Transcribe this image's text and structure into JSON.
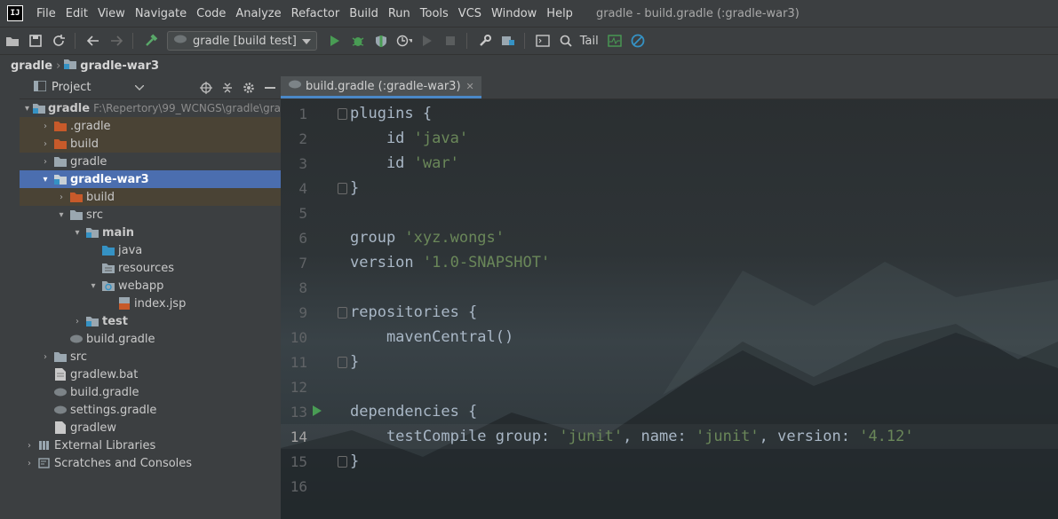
{
  "menubar": {
    "items": [
      "File",
      "Edit",
      "View",
      "Navigate",
      "Code",
      "Analyze",
      "Refactor",
      "Build",
      "Run",
      "Tools",
      "VCS",
      "Window",
      "Help"
    ],
    "window_title": "gradle - build.gradle (:gradle-war3)"
  },
  "toolbar": {
    "run_config": "gradle [build test]",
    "tail_label": "Tail"
  },
  "breadcrumb": [
    "gradle",
    "gradle-war3"
  ],
  "project_panel": {
    "title": "Project"
  },
  "tree": [
    {
      "label": "gradle",
      "path": "F:\\Repertory\\99_WCNGS\\gradle\\gra",
      "bold": true,
      "expanded": true
    },
    {
      "label": ".gradle",
      "excluded": true
    },
    {
      "label": "build",
      "excluded": true
    },
    {
      "label": "gradle"
    },
    {
      "label": "gradle-war3",
      "selected": true,
      "bold": true
    },
    {
      "label": "build",
      "excluded": true
    },
    {
      "label": "src"
    },
    {
      "label": "main",
      "bold": true
    },
    {
      "label": "java"
    },
    {
      "label": "resources"
    },
    {
      "label": "webapp"
    },
    {
      "label": "index.jsp"
    },
    {
      "label": "test",
      "bold": true
    },
    {
      "label": "build.gradle"
    },
    {
      "label": "src"
    },
    {
      "label": "gradlew.bat"
    },
    {
      "label": "build.gradle"
    },
    {
      "label": "settings.gradle"
    },
    {
      "label": "gradlew"
    },
    {
      "label": "External Libraries"
    },
    {
      "label": "Scratches and Consoles"
    }
  ],
  "editor": {
    "tab_label": "build.gradle (:gradle-war3)",
    "current_line": 14,
    "lines": [
      {
        "n": "1",
        "code": "plugins {"
      },
      {
        "n": "2",
        "code": "    id 'java'"
      },
      {
        "n": "3",
        "code": "    id 'war'"
      },
      {
        "n": "4",
        "code": "}"
      },
      {
        "n": "5",
        "code": ""
      },
      {
        "n": "6",
        "code": "group 'xyz.wongs'"
      },
      {
        "n": "7",
        "code": "version '1.0-SNAPSHOT'"
      },
      {
        "n": "8",
        "code": ""
      },
      {
        "n": "9",
        "code": "repositories {"
      },
      {
        "n": "10",
        "code": "    mavenCentral()"
      },
      {
        "n": "11",
        "code": "}"
      },
      {
        "n": "12",
        "code": ""
      },
      {
        "n": "13",
        "code": "dependencies {"
      },
      {
        "n": "14",
        "code": "    testCompile group: 'junit', name: 'junit', version: '4.12'"
      },
      {
        "n": "15",
        "code": "}"
      },
      {
        "n": "16",
        "code": ""
      }
    ]
  },
  "colors": {
    "accent": "#4b6eaf",
    "string": "#6a8759",
    "run": "#499c54",
    "excluded_folder": "#c75a2a"
  }
}
